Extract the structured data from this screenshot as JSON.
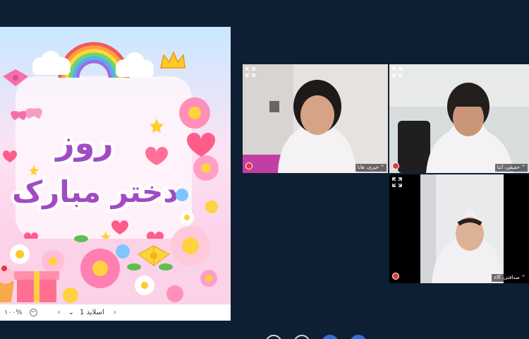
{
  "slide": {
    "title_line1": "روز",
    "title_line2": "دختر مبارک",
    "toolbar": {
      "zoom": "۱۰۰%",
      "zoom_out_icon": "minus-circle-icon",
      "prev_icon": "chevron-left-icon",
      "dropdown_icon": "chevron-down-icon",
      "slide_label": "اسلاید 1",
      "next_icon": "chevron-right-icon"
    }
  },
  "participants": [
    {
      "name": "^ خیری، هانا",
      "expand_icon": "expand-icon",
      "mic_icon": "mic-muted-icon"
    },
    {
      "name": "^ حقیقی، آتنا",
      "expand_icon": "expand-icon",
      "mic_icon": "mic-muted-icon"
    },
    {
      "name": "^ صداقتی، آلاء",
      "expand_icon": "expand-icon",
      "mic_icon": "mic-muted-icon"
    }
  ],
  "colors": {
    "background": "#0f1f33",
    "title_purple": "#a04bc4",
    "accent_blue": "#2f6fde",
    "mic_red": "#e53935"
  }
}
